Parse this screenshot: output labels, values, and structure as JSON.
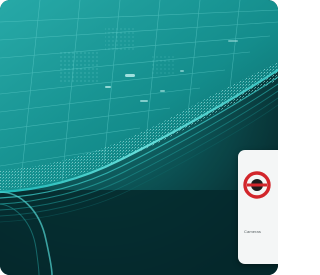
{
  "image": {
    "subject": "teal-wireframe-surface-render",
    "palette": {
      "background": "#0a3d40",
      "glow": "#4ee8ea",
      "edge": "#9ff7f4"
    }
  },
  "badge": {
    "caption": "Cameras",
    "logo_icon": "red-circle-logo-icon",
    "logo_color": "#d2262b"
  }
}
